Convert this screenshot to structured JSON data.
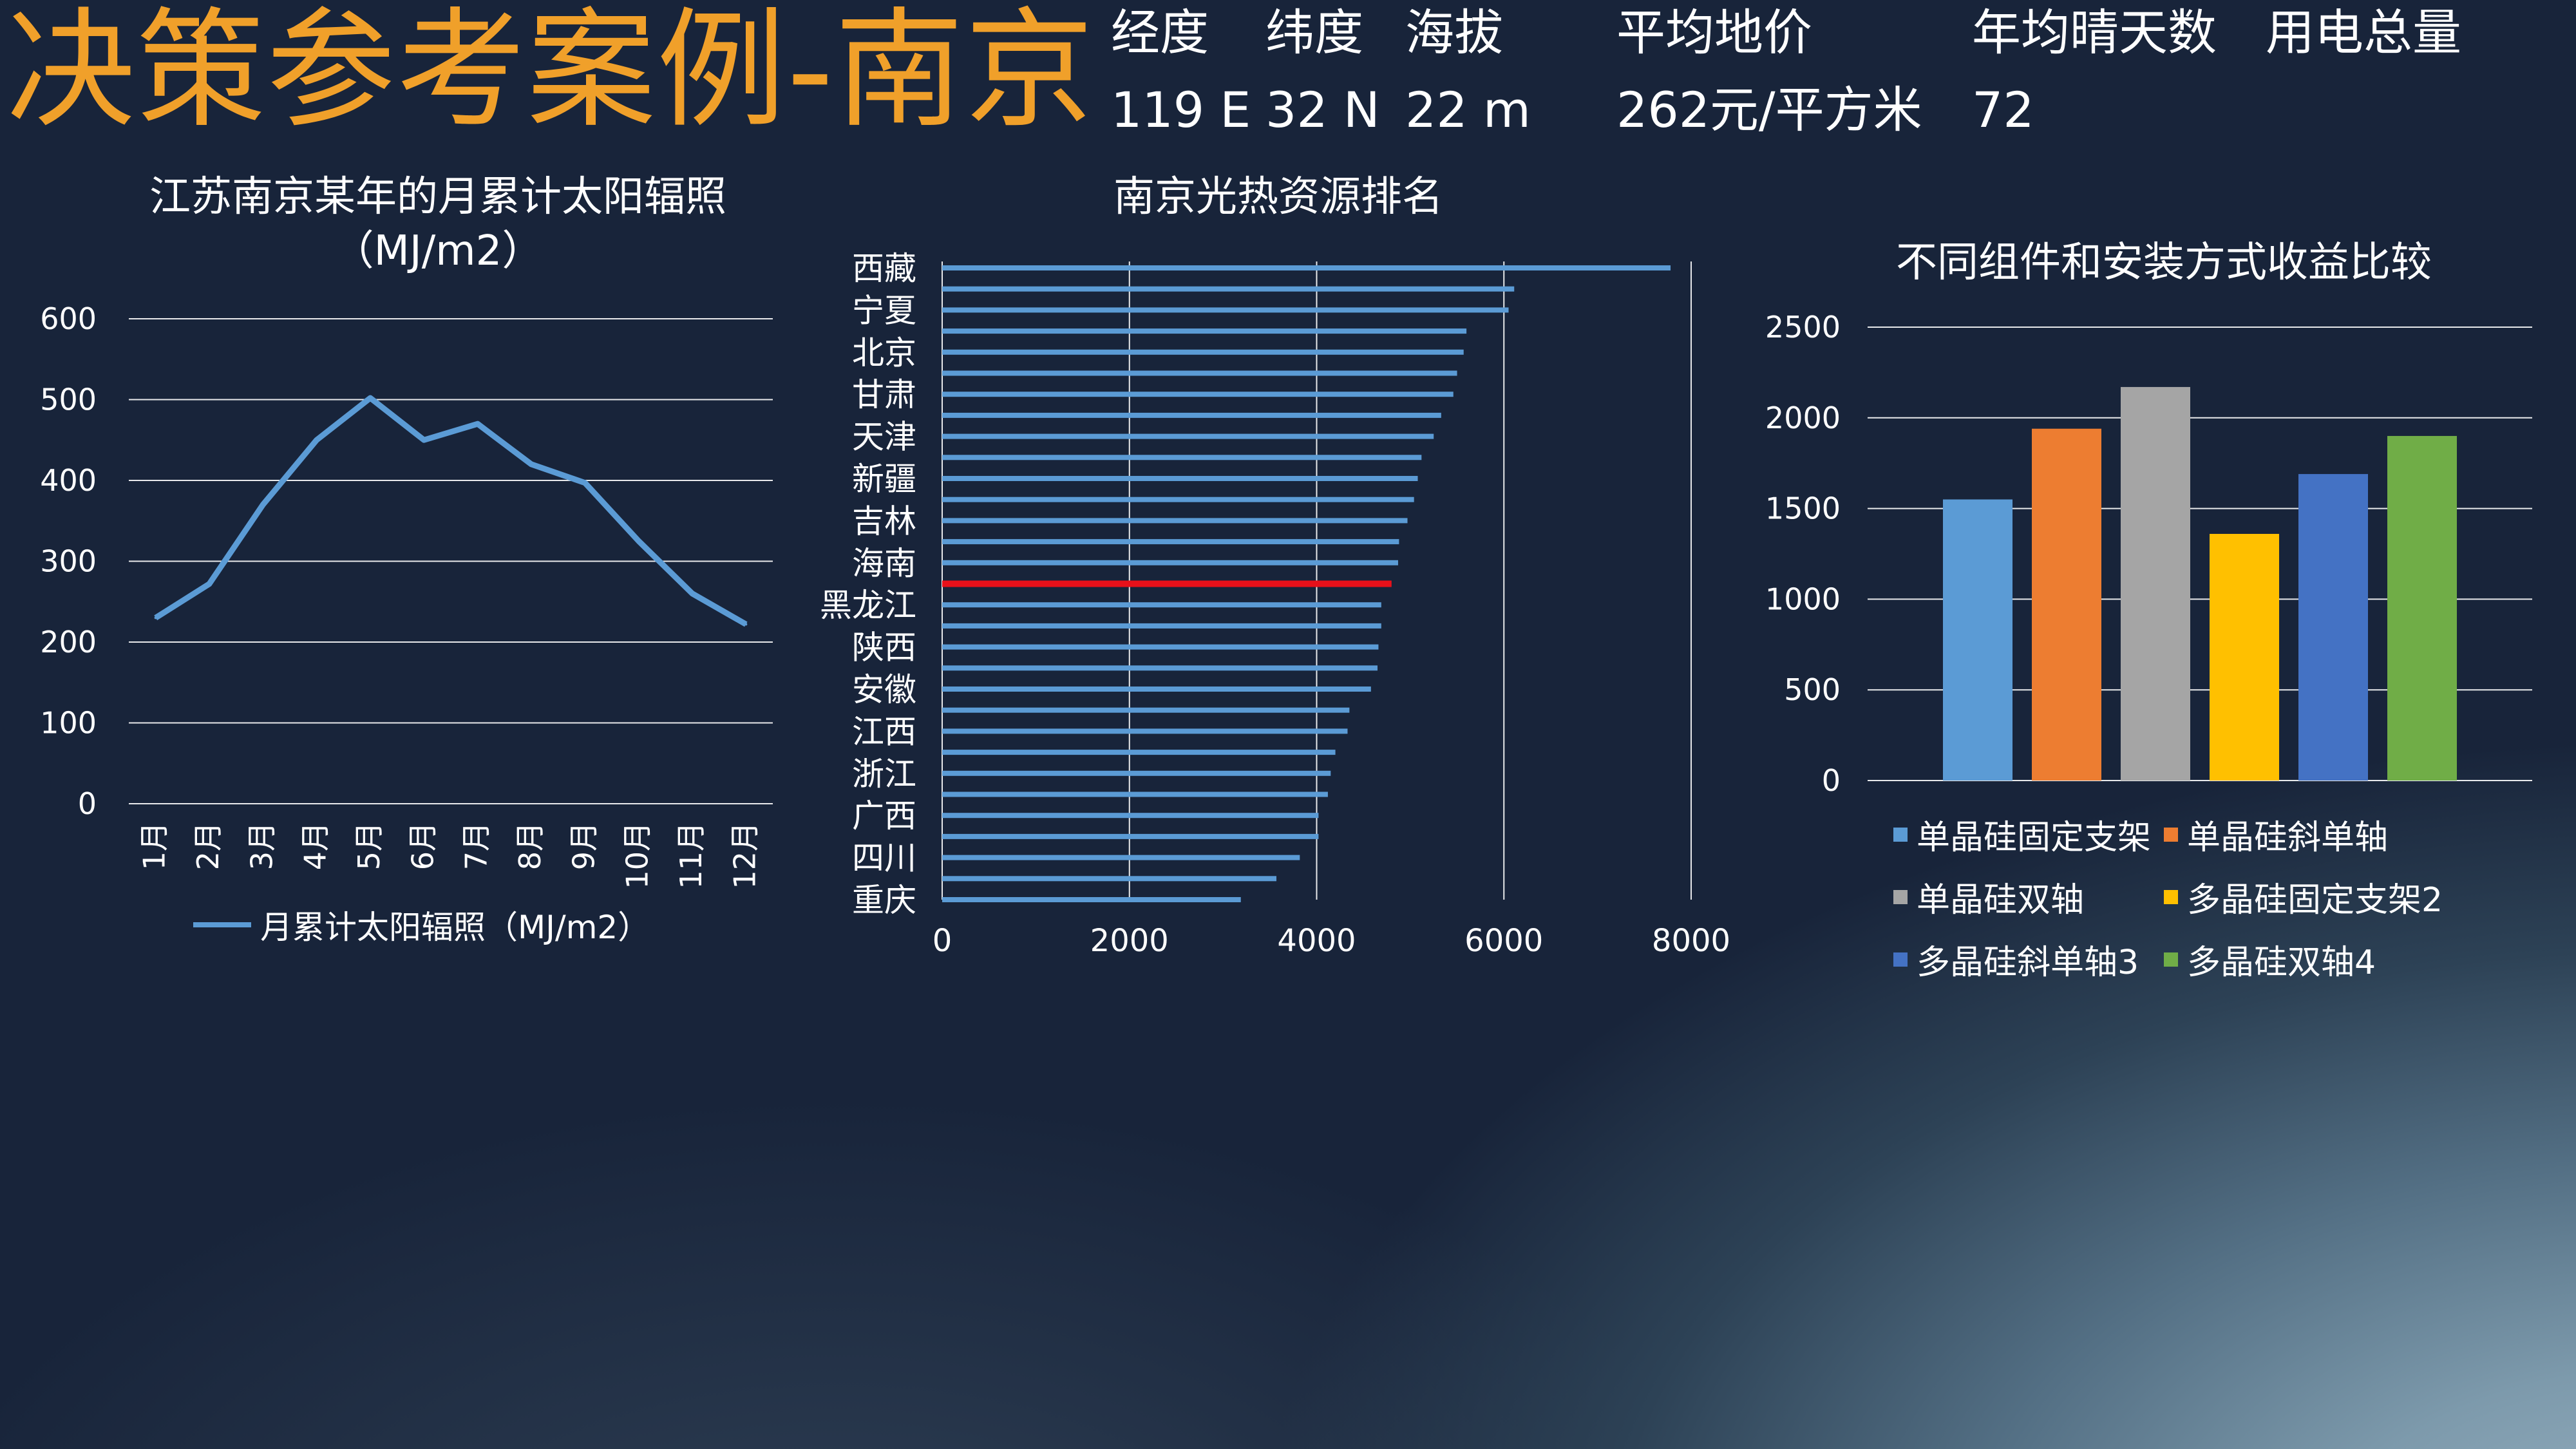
{
  "title": "决策参考案例-南京",
  "info": {
    "labels": [
      "经度",
      "纬度",
      "海拔",
      "平均地价",
      "年均晴天数",
      "用电总量"
    ],
    "values": [
      "119 E",
      "32 N",
      "22 m",
      "262元/平方米",
      "72"
    ]
  },
  "colors": {
    "title": "#f0a02a",
    "line": "#5b9bd5",
    "hbar": "#5b9bd5",
    "highlight": "#e8101a",
    "grid": "#ffffff"
  },
  "chart_data": [
    {
      "type": "line",
      "title": "江苏南京某年的月累计太阳辐照（MJ/m2）",
      "categories": [
        "1月",
        "2月",
        "3月",
        "4月",
        "5月",
        "6月",
        "7月",
        "8月",
        "9月",
        "10月",
        "11月",
        "12月"
      ],
      "series": [
        {
          "name": "月累计太阳辐照（MJ/m2）",
          "values": [
            230,
            272,
            370,
            450,
            502,
            450,
            470,
            420,
            397,
            325,
            260,
            222
          ]
        }
      ],
      "ylim": [
        0,
        600
      ],
      "yticks": [
        0,
        100,
        200,
        300,
        400,
        500,
        600
      ],
      "grid": true,
      "legend": "bottom"
    },
    {
      "type": "bar",
      "orientation": "horizontal",
      "title": "南京光热资源排名",
      "category_labels": [
        "西藏",
        "宁夏",
        "北京",
        "甘肃",
        "天津",
        "新疆",
        "吉林",
        "海南",
        "黑龙江",
        "陕西",
        "安徽",
        "江西",
        "浙江",
        "广西",
        "四川",
        "重庆"
      ],
      "values": [
        7780,
        6110,
        6050,
        5600,
        5570,
        5500,
        5460,
        5330,
        5250,
        5120,
        5080,
        5040,
        4970,
        4880,
        4870,
        4800,
        4690,
        4690,
        4660,
        4650,
        4580,
        4350,
        4330,
        4200,
        4150,
        4120,
        4020,
        4020,
        3820,
        3570,
        3190
      ],
      "highlight_index": 15,
      "xlim": [
        0,
        8000
      ],
      "xticks": [
        0,
        2000,
        4000,
        6000,
        8000
      ],
      "grid": true
    },
    {
      "type": "bar",
      "title": "不同组件和安装方式收益比较",
      "series": [
        {
          "name": "单晶硅固定支架",
          "value": 1550,
          "color": "#5b9bd5"
        },
        {
          "name": "单晶硅斜单轴",
          "value": 1940,
          "color": "#ed7d31"
        },
        {
          "name": "单晶硅双轴",
          "value": 2170,
          "color": "#a5a5a5"
        },
        {
          "name": "多晶硅固定支架2",
          "value": 1360,
          "color": "#ffc000"
        },
        {
          "name": "多晶硅斜单轴3",
          "value": 1690,
          "color": "#4472c4"
        },
        {
          "name": "多晶硅双轴4",
          "value": 1900,
          "color": "#70ad47"
        }
      ],
      "ylim": [
        0,
        2500
      ],
      "yticks": [
        0,
        500,
        1000,
        1500,
        2000,
        2500
      ],
      "grid": true,
      "legend": "bottom"
    }
  ]
}
